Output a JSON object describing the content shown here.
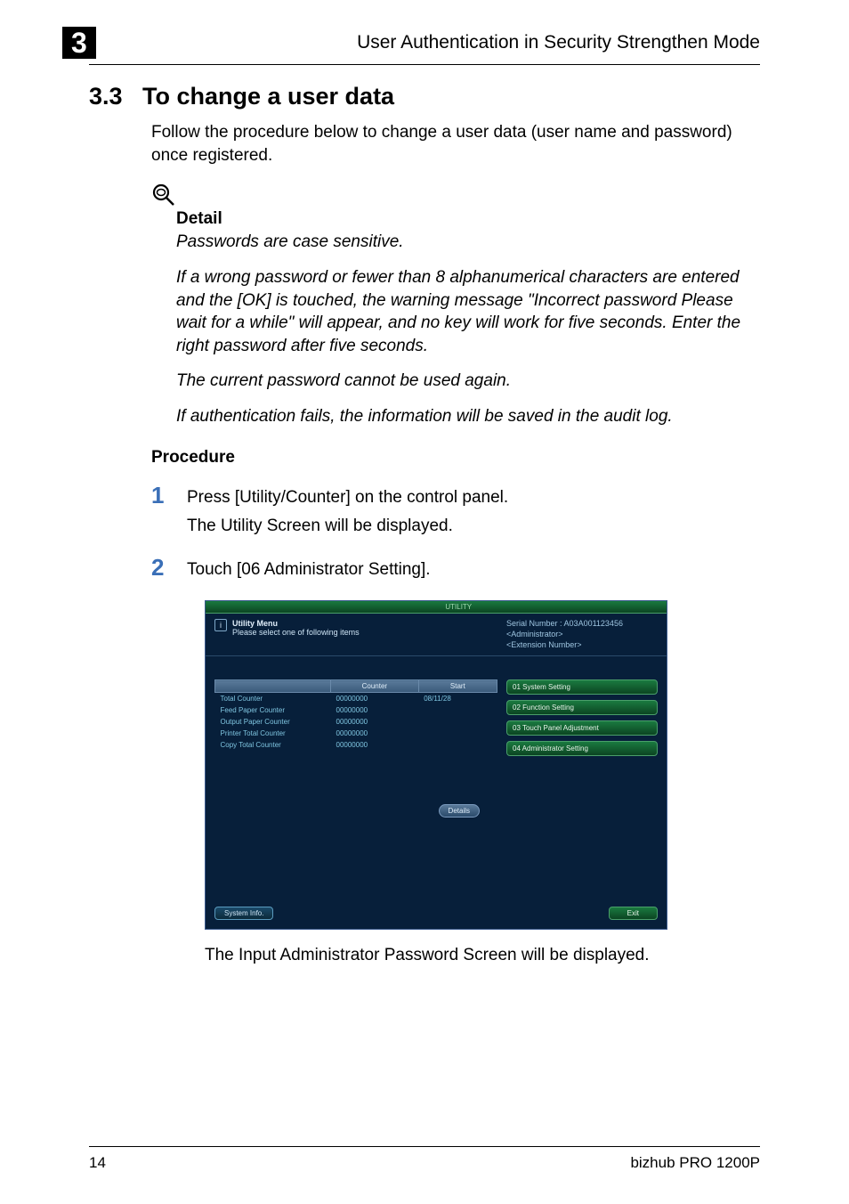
{
  "header": {
    "chapter_number": "3",
    "title": "User Authentication in Security Strengthen Mode"
  },
  "section": {
    "number": "3.3",
    "title": "To change a user data",
    "intro": "Follow the procedure below to change a user data (user name and password) once registered."
  },
  "detail": {
    "label": "Detail",
    "p1": "Passwords are case sensitive.",
    "p2": "If a wrong password or fewer than 8 alphanumerical characters are entered and the [OK] is touched, the warning message \"Incorrect password Please wait for a while\" will appear, and no key will work for five seconds. Enter the right password after five seconds.",
    "p3": "The current password cannot be used again.",
    "p4": "If authentication fails, the information will be saved in the audit log."
  },
  "procedure": {
    "label": "Procedure",
    "steps": [
      {
        "num": "1",
        "text": "Press [Utility/Counter] on the control panel.",
        "sub": "The Utility Screen will be displayed."
      },
      {
        "num": "2",
        "text": "Touch [06 Administrator Setting]."
      }
    ]
  },
  "screenshot": {
    "title": "UTILITY",
    "header_left_line1": "Utility Menu",
    "header_left_line2": "Please select one of following items",
    "serial_label": "Serial Number",
    "serial_value": ": A03A001123456",
    "admin_label": "<Administrator>",
    "ext_label": "<Extension Number>",
    "table": {
      "h_blank": "",
      "h_counter": "Counter",
      "h_start": "Start",
      "rows": [
        {
          "label": "Total Counter",
          "counter": "00000000",
          "start": "08/11/28"
        },
        {
          "label": "Feed Paper Counter",
          "counter": "00000000",
          "start": ""
        },
        {
          "label": "Output Paper Counter",
          "counter": "00000000",
          "start": ""
        },
        {
          "label": "Printer Total Counter",
          "counter": "00000000",
          "start": ""
        },
        {
          "label": "Copy Total Counter",
          "counter": "00000000",
          "start": ""
        }
      ]
    },
    "details_btn": "Details",
    "menu": [
      "01 System Setting",
      "02 Function Setting",
      "03 Touch Panel Adjustment",
      "04 Administrator Setting"
    ],
    "sysinfo_btn": "System Info.",
    "exit_btn": "Exit"
  },
  "caption": "The Input Administrator Password Screen will be displayed.",
  "footer": {
    "page": "14",
    "product": "bizhub PRO 1200P"
  }
}
